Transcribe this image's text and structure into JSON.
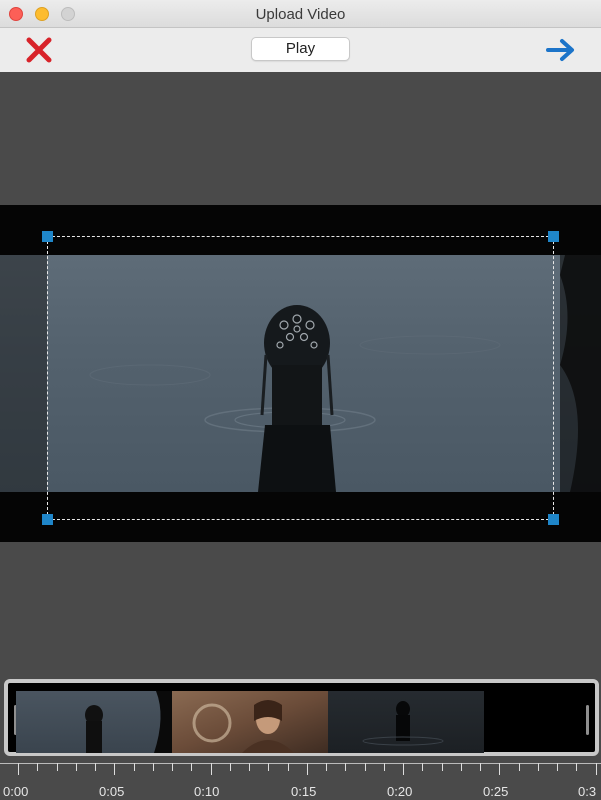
{
  "window": {
    "title": "Upload Video"
  },
  "toolbar": {
    "cancel_icon": "close-x-icon",
    "play_label": "Play",
    "next_icon": "arrow-right-icon",
    "colors": {
      "cancel": "#d8232a",
      "next": "#1c74c9"
    }
  },
  "video": {
    "crop_handle_color": "#1f86c9"
  },
  "timeline": {
    "thumbnails": [
      {
        "name": "thumbnail-1",
        "description": "head above water"
      },
      {
        "name": "thumbnail-2",
        "description": "woman in warm interior"
      },
      {
        "name": "thumbnail-3",
        "description": "figure in dark water"
      }
    ],
    "ruler_labels": [
      "0:00",
      "0:05",
      "0:10",
      "0:15",
      "0:20",
      "0:25",
      "0:3"
    ]
  }
}
